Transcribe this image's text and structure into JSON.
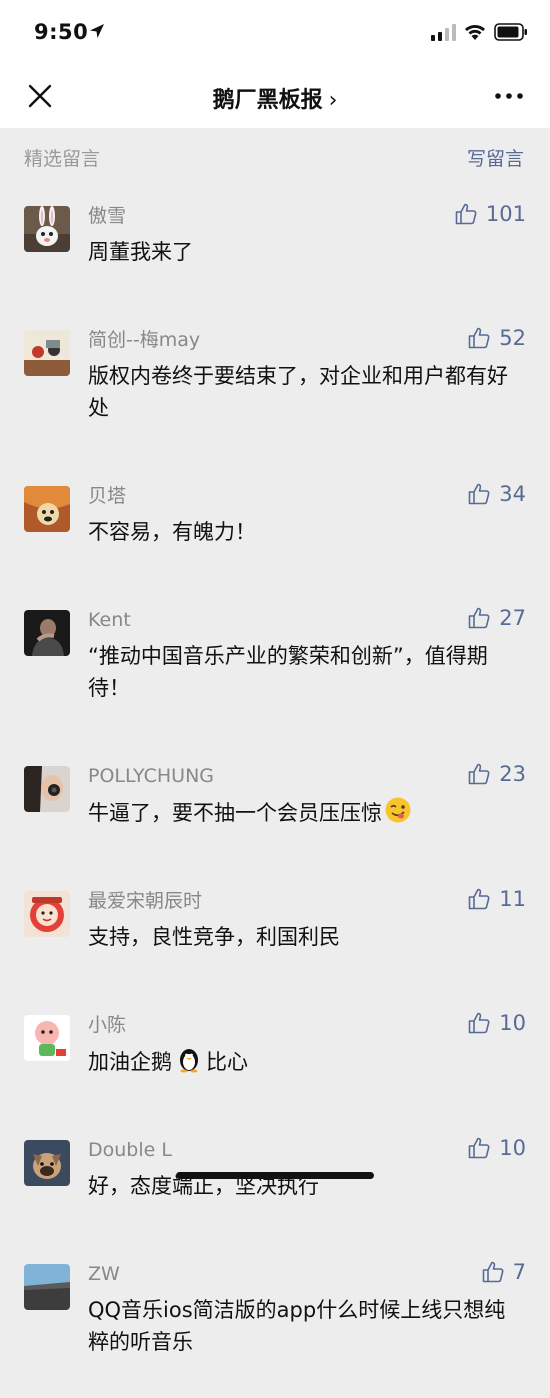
{
  "status": {
    "time": "9:50"
  },
  "nav": {
    "title": "鹅厂黑板报",
    "chevron": "›"
  },
  "section": {
    "title": "精选留言",
    "write_label": "写留言"
  },
  "comments": [
    {
      "name": "傲雪",
      "text": "周董我来了",
      "likes": "101"
    },
    {
      "name": "简创--梅may",
      "text": "版权内卷终于要结束了，对企业和用户都有好处",
      "likes": "52"
    },
    {
      "name": "贝塔",
      "text": "不容易，有魄力！",
      "likes": "34"
    },
    {
      "name": "Kent",
      "text": "“推动中国音乐产业的繁荣和创新”，值得期待！",
      "likes": "27"
    },
    {
      "name": "POLLYCHUNG",
      "text": "牛逼了，要不抽一个会员压压惊",
      "likes": "23"
    },
    {
      "name": "最爱宋朝辰时",
      "text": "支持，良性竞争，利国利民",
      "likes": "11"
    },
    {
      "name": "小陈",
      "text_parts": [
        "加油企鹅",
        "比心"
      ],
      "likes": "10"
    },
    {
      "name": "Double L",
      "text": "好，态度端正，坚决执行",
      "likes": "10"
    },
    {
      "name": "ZW",
      "text": "QQ音乐ios简洁版的app什么时候上线只想纯粹的听音乐",
      "likes": "7"
    }
  ],
  "colors": {
    "background": "#ededed",
    "link": "#576b95",
    "muted": "#888888"
  },
  "icons": {
    "close": "close-icon",
    "more": "more-icon",
    "like": "thumbs-up-icon"
  }
}
